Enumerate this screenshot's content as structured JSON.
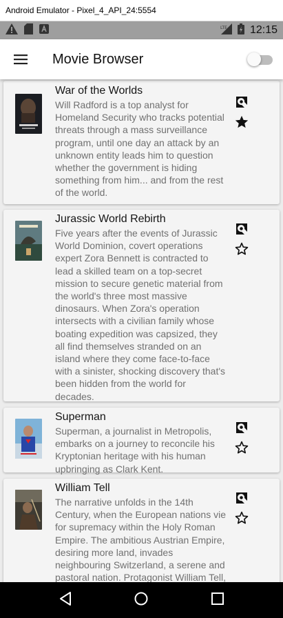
{
  "window": {
    "title": "Android Emulator - Pixel_4_API_24:5554"
  },
  "status_bar": {
    "time": "12:15",
    "network": "LTE"
  },
  "app_bar": {
    "title": "Movie Browser",
    "toggle_on": false
  },
  "colors": {
    "app_bar": "#ffffff",
    "card": "#f4f4f4",
    "desc_text": "#707070",
    "status_bar": "#9e9e9e"
  },
  "movies": [
    {
      "title": "War of the Worlds",
      "description": "Will Radford is a top analyst for Homeland Security who tracks potential threats through a mass surveillance program, until one day an attack by an unknown entity leads him to question whether the government is hiding something from him... and from the rest of the world.",
      "favorite": true,
      "poster_icon": "war-of-the-worlds-poster"
    },
    {
      "title": "Jurassic World Rebirth",
      "description": "Five years after the events of Jurassic World Dominion, covert operations expert Zora Bennett is contracted to lead a skilled team on a top-secret mission to secure genetic material from the world's three most massive dinosaurs. When Zora's operation intersects with a civilian family whose boating expedition was capsized, they all find themselves stranded on an island where they come face-to-face with a sinister, shocking discovery that's been hidden from the world for decades.",
      "favorite": false,
      "poster_icon": "jurassic-world-rebirth-poster"
    },
    {
      "title": "Superman",
      "description": "Superman, a journalist in Metropolis, embarks on a journey to reconcile his Kryptonian heritage with his human upbringing as Clark Kent.",
      "favorite": false,
      "poster_icon": "superman-poster"
    },
    {
      "title": "William Tell",
      "description": "The narrative unfolds in the 14th Century, when the European nations vie for supremacy within the Holy Roman Empire. The ambitious Austrian Empire, desiring more land, invades neighbouring Switzerland, a serene and pastoral nation. Protagonist William Tell, a formerly",
      "favorite": false,
      "poster_icon": "william-tell-poster"
    }
  ]
}
